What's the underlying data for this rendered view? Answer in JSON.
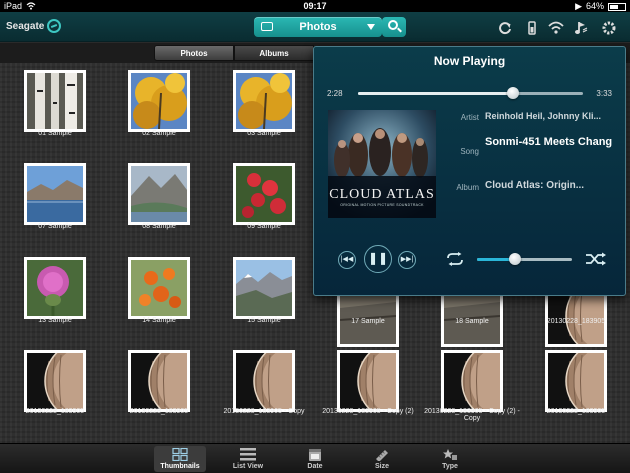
{
  "status_bar": {
    "device": "iPad",
    "time": "09:17",
    "battery": "64%",
    "battery_level": 0.64
  },
  "app_bar": {
    "brand": "Seagate",
    "library_select": "Photos",
    "icons": [
      "refresh-icon",
      "battery-device-icon",
      "wifi-icon",
      "music-note-icon",
      "gear-icon"
    ]
  },
  "segments": [
    {
      "label": "Photos",
      "selected": true
    },
    {
      "label": "Albums",
      "selected": false
    }
  ],
  "photos": [
    {
      "caption": "01 Sample",
      "kind": "birch"
    },
    {
      "caption": "02 Sample",
      "kind": "yellow"
    },
    {
      "caption": "03 Sample",
      "kind": "yellow"
    },
    {
      "caption": "07 Sample",
      "kind": "lake"
    },
    {
      "caption": "08 Sample",
      "kind": "mountain"
    },
    {
      "caption": "09 Sample",
      "kind": "redflower"
    },
    {
      "caption": "13 Sample",
      "kind": "thistle"
    },
    {
      "caption": "14 Sample",
      "kind": "orange"
    },
    {
      "caption": "15 Sample",
      "kind": "valley"
    },
    {
      "caption": "17 Sample",
      "kind": "rock"
    },
    {
      "caption": "18 Sample",
      "kind": "rock"
    },
    {
      "caption": "20130228_183905",
      "kind": "planet"
    },
    {
      "caption": "20130228_183905",
      "kind": "planet"
    },
    {
      "caption": "20130228_183905",
      "kind": "planet"
    },
    {
      "caption": "20130228_183905 - Copy",
      "kind": "planet"
    },
    {
      "caption": "20130228_183905 - Copy (2)",
      "kind": "planet"
    },
    {
      "caption": "20130228_183905 - Copy (2) - Copy",
      "kind": "planet"
    },
    {
      "caption": "20130228_183905",
      "kind": "planet"
    }
  ],
  "now_playing": {
    "title": "Now Playing",
    "elapsed": "2:28",
    "duration": "3:33",
    "progress": 0.69,
    "labels": {
      "artist": "Artist",
      "song": "Song",
      "album": "Album"
    },
    "artist": "Reinhold Heil, Johnny Kli...",
    "song": "Sonmi-451 Meets Chang",
    "album": "Cloud Atlas: Origin...",
    "album_art": {
      "title": "CLOUD ATLAS",
      "subtitle": "ORIGINAL MOTION PICTURE SOUNDTRACK"
    },
    "volume": 0.4,
    "controls": [
      "previous-icon",
      "pause-icon",
      "next-icon",
      "repeat-icon",
      "shuffle-icon"
    ]
  },
  "tab_bar": [
    {
      "label": "Thumbnails",
      "active": true
    },
    {
      "label": "List View",
      "active": false
    },
    {
      "label": "Date",
      "active": false
    },
    {
      "label": "Size",
      "active": false
    },
    {
      "label": "Type",
      "active": false
    }
  ],
  "colors": {
    "accent": "#1fa6a2",
    "popover": "#0a3346"
  }
}
